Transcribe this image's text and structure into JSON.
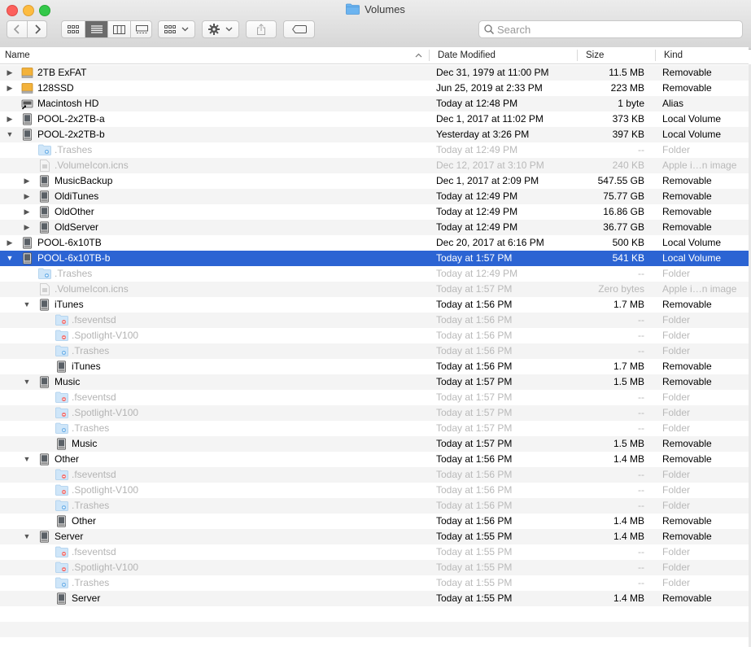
{
  "window": {
    "title": "Volumes"
  },
  "toolbar": {
    "search_placeholder": "Search"
  },
  "columns": {
    "name": "Name",
    "date": "Date Modified",
    "size": "Size",
    "kind": "Kind"
  },
  "rows": [
    {
      "name": "2TB ExFAT",
      "date": "Dec 31, 1979 at 11:00 PM",
      "size": "11.5 MB",
      "kind": "Removable",
      "level": 0,
      "tri": "right",
      "icon": "external-drive-icon",
      "dim": false
    },
    {
      "name": "128SSD",
      "date": "Jun 25, 2019 at 2:33 PM",
      "size": "223 MB",
      "kind": "Removable",
      "level": 0,
      "tri": "right",
      "icon": "external-drive-icon",
      "dim": false
    },
    {
      "name": "Macintosh HD",
      "date": "Today at 12:48 PM",
      "size": "1 byte",
      "kind": "Alias",
      "level": 0,
      "tri": "none",
      "icon": "alias-drive-icon",
      "dim": false
    },
    {
      "name": "POOL-2x2TB-a",
      "date": "Dec 1, 2017 at 11:02 PM",
      "size": "373 KB",
      "kind": "Local Volume",
      "level": 0,
      "tri": "right",
      "icon": "drive-icon",
      "dim": false
    },
    {
      "name": "POOL-2x2TB-b",
      "date": "Yesterday at 3:26 PM",
      "size": "397 KB",
      "kind": "Local Volume",
      "level": 0,
      "tri": "down",
      "icon": "drive-icon",
      "dim": false
    },
    {
      "name": ".Trashes",
      "date": "Today at 12:49 PM",
      "size": "--",
      "kind": "Folder",
      "level": 1,
      "tri": "none",
      "icon": "trash-folder-icon",
      "dim": true
    },
    {
      "name": ".VolumeIcon.icns",
      "date": "Dec 12, 2017 at 3:10 PM",
      "size": "240 KB",
      "kind": "Apple i…n image",
      "level": 1,
      "tri": "none",
      "icon": "icns-file-icon",
      "dim": true
    },
    {
      "name": "MusicBackup",
      "date": "Dec 1, 2017 at 2:09 PM",
      "size": "547.55 GB",
      "kind": "Removable",
      "level": 1,
      "tri": "right",
      "icon": "drive-icon",
      "dim": false
    },
    {
      "name": "OldiTunes",
      "date": "Today at 12:49 PM",
      "size": "75.77 GB",
      "kind": "Removable",
      "level": 1,
      "tri": "right",
      "icon": "drive-icon",
      "dim": false
    },
    {
      "name": "OldOther",
      "date": "Today at 12:49 PM",
      "size": "16.86 GB",
      "kind": "Removable",
      "level": 1,
      "tri": "right",
      "icon": "drive-icon",
      "dim": false
    },
    {
      "name": "OldServer",
      "date": "Today at 12:49 PM",
      "size": "36.77 GB",
      "kind": "Removable",
      "level": 1,
      "tri": "right",
      "icon": "drive-icon",
      "dim": false
    },
    {
      "name": "POOL-6x10TB",
      "date": "Dec 20, 2017 at 6:16 PM",
      "size": "500 KB",
      "kind": "Local Volume",
      "level": 0,
      "tri": "right",
      "icon": "drive-icon",
      "dim": false
    },
    {
      "name": "POOL-6x10TB-b",
      "date": "Today at 1:57 PM",
      "size": "541 KB",
      "kind": "Local Volume",
      "level": 0,
      "tri": "down",
      "icon": "drive-icon",
      "dim": false,
      "selected": true
    },
    {
      "name": ".Trashes",
      "date": "Today at 12:49 PM",
      "size": "--",
      "kind": "Folder",
      "level": 1,
      "tri": "none",
      "icon": "trash-folder-icon",
      "dim": true
    },
    {
      "name": ".VolumeIcon.icns",
      "date": "Today at 1:57 PM",
      "size": "Zero bytes",
      "kind": "Apple i…n image",
      "level": 1,
      "tri": "none",
      "icon": "icns-file-icon",
      "dim": true
    },
    {
      "name": "iTunes",
      "date": "Today at 1:56 PM",
      "size": "1.7 MB",
      "kind": "Removable",
      "level": 1,
      "tri": "down",
      "icon": "drive-icon",
      "dim": false
    },
    {
      "name": ".fseventsd",
      "date": "Today at 1:56 PM",
      "size": "--",
      "kind": "Folder",
      "level": 2,
      "tri": "none",
      "icon": "restricted-folder-icon",
      "dim": true
    },
    {
      "name": ".Spotlight-V100",
      "date": "Today at 1:56 PM",
      "size": "--",
      "kind": "Folder",
      "level": 2,
      "tri": "none",
      "icon": "restricted-folder-icon",
      "dim": true
    },
    {
      "name": ".Trashes",
      "date": "Today at 1:56 PM",
      "size": "--",
      "kind": "Folder",
      "level": 2,
      "tri": "none",
      "icon": "trash-folder-icon",
      "dim": true
    },
    {
      "name": "iTunes",
      "date": "Today at 1:56 PM",
      "size": "1.7 MB",
      "kind": "Removable",
      "level": 2,
      "tri": "none",
      "icon": "drive-icon",
      "dim": false
    },
    {
      "name": "Music",
      "date": "Today at 1:57 PM",
      "size": "1.5 MB",
      "kind": "Removable",
      "level": 1,
      "tri": "down",
      "icon": "drive-icon",
      "dim": false
    },
    {
      "name": ".fseventsd",
      "date": "Today at 1:57 PM",
      "size": "--",
      "kind": "Folder",
      "level": 2,
      "tri": "none",
      "icon": "restricted-folder-icon",
      "dim": true
    },
    {
      "name": ".Spotlight-V100",
      "date": "Today at 1:57 PM",
      "size": "--",
      "kind": "Folder",
      "level": 2,
      "tri": "none",
      "icon": "restricted-folder-icon",
      "dim": true
    },
    {
      "name": ".Trashes",
      "date": "Today at 1:57 PM",
      "size": "--",
      "kind": "Folder",
      "level": 2,
      "tri": "none",
      "icon": "trash-folder-icon",
      "dim": true
    },
    {
      "name": "Music",
      "date": "Today at 1:57 PM",
      "size": "1.5 MB",
      "kind": "Removable",
      "level": 2,
      "tri": "none",
      "icon": "drive-icon",
      "dim": false
    },
    {
      "name": "Other",
      "date": "Today at 1:56 PM",
      "size": "1.4 MB",
      "kind": "Removable",
      "level": 1,
      "tri": "down",
      "icon": "drive-icon",
      "dim": false
    },
    {
      "name": ".fseventsd",
      "date": "Today at 1:56 PM",
      "size": "--",
      "kind": "Folder",
      "level": 2,
      "tri": "none",
      "icon": "restricted-folder-icon",
      "dim": true
    },
    {
      "name": ".Spotlight-V100",
      "date": "Today at 1:56 PM",
      "size": "--",
      "kind": "Folder",
      "level": 2,
      "tri": "none",
      "icon": "restricted-folder-icon",
      "dim": true
    },
    {
      "name": ".Trashes",
      "date": "Today at 1:56 PM",
      "size": "--",
      "kind": "Folder",
      "level": 2,
      "tri": "none",
      "icon": "trash-folder-icon",
      "dim": true
    },
    {
      "name": "Other",
      "date": "Today at 1:56 PM",
      "size": "1.4 MB",
      "kind": "Removable",
      "level": 2,
      "tri": "none",
      "icon": "drive-icon",
      "dim": false
    },
    {
      "name": "Server",
      "date": "Today at 1:55 PM",
      "size": "1.4 MB",
      "kind": "Removable",
      "level": 1,
      "tri": "down",
      "icon": "drive-icon",
      "dim": false
    },
    {
      "name": ".fseventsd",
      "date": "Today at 1:55 PM",
      "size": "--",
      "kind": "Folder",
      "level": 2,
      "tri": "none",
      "icon": "restricted-folder-icon",
      "dim": true
    },
    {
      "name": ".Spotlight-V100",
      "date": "Today at 1:55 PM",
      "size": "--",
      "kind": "Folder",
      "level": 2,
      "tri": "none",
      "icon": "restricted-folder-icon",
      "dim": true
    },
    {
      "name": ".Trashes",
      "date": "Today at 1:55 PM",
      "size": "--",
      "kind": "Folder",
      "level": 2,
      "tri": "none",
      "icon": "trash-folder-icon",
      "dim": true
    },
    {
      "name": "Server",
      "date": "Today at 1:55 PM",
      "size": "1.4 MB",
      "kind": "Removable",
      "level": 2,
      "tri": "none",
      "icon": "drive-icon",
      "dim": false
    }
  ]
}
